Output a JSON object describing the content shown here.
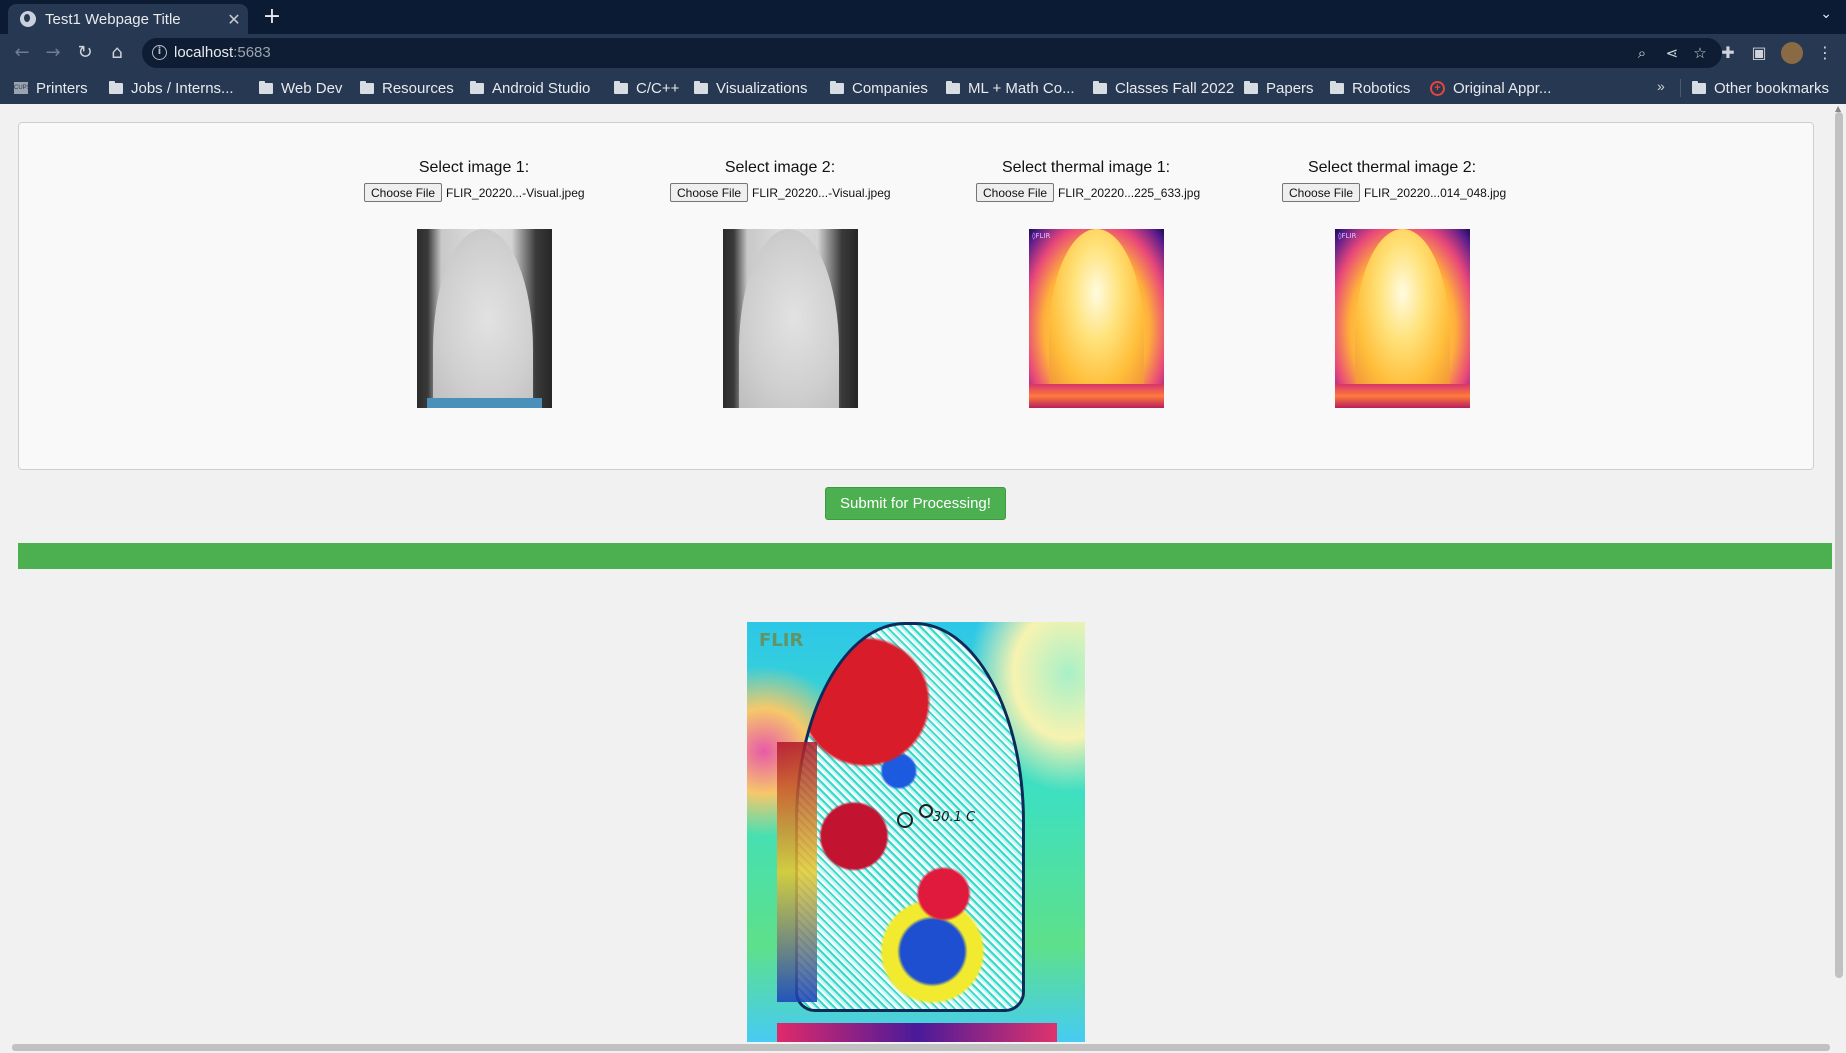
{
  "browser": {
    "tab_title": "Test1 Webpage Title",
    "tab_close": "✕",
    "new_tab": "+",
    "tab_menu": "⌄",
    "url_host": "localhost",
    "url_port": ":5683",
    "bookmarks": [
      {
        "label": "Printers",
        "icon": "printer-icon"
      },
      {
        "label": "Jobs / Interns...",
        "icon": "folder-icon"
      },
      {
        "label": "Web Dev",
        "icon": "folder-icon"
      },
      {
        "label": "Resources",
        "icon": "folder-icon"
      },
      {
        "label": "Android Studio",
        "icon": "folder-icon"
      },
      {
        "label": "C/C++",
        "icon": "folder-icon"
      },
      {
        "label": "Visualizations",
        "icon": "folder-icon"
      },
      {
        "label": "Companies",
        "icon": "folder-icon"
      },
      {
        "label": "ML + Math Co...",
        "icon": "folder-icon"
      },
      {
        "label": "Classes Fall 2022",
        "icon": "folder-icon"
      },
      {
        "label": "Papers",
        "icon": "folder-icon"
      },
      {
        "label": "Robotics",
        "icon": "folder-icon"
      },
      {
        "label": "Original Appr...",
        "icon": "red-plus-icon"
      }
    ],
    "bookmarks_more": "»",
    "other_bookmarks": "Other bookmarks"
  },
  "upload": {
    "choose_label": "Choose File",
    "slots": [
      {
        "label": "Select image 1:",
        "file": "FLIR_20220...-Visual.jpeg",
        "type": "visual"
      },
      {
        "label": "Select image 2:",
        "file": "FLIR_20220...-Visual.jpeg",
        "type": "visual"
      },
      {
        "label": "Select thermal image 1:",
        "file": "FLIR_20220...225_633.jpg",
        "type": "thermal"
      },
      {
        "label": "Select thermal image 2:",
        "file": "FLIR_20220...014_048.jpg",
        "type": "thermal"
      }
    ]
  },
  "submit_label": "Submit for Processing!",
  "progress": {
    "fraction": 1.0,
    "color": "#4caf50"
  },
  "result": {
    "watermark": "FLIR",
    "temp_reading": "30.1 C"
  },
  "colors": {
    "accent": "#4caf50",
    "chrome": "#263852"
  }
}
